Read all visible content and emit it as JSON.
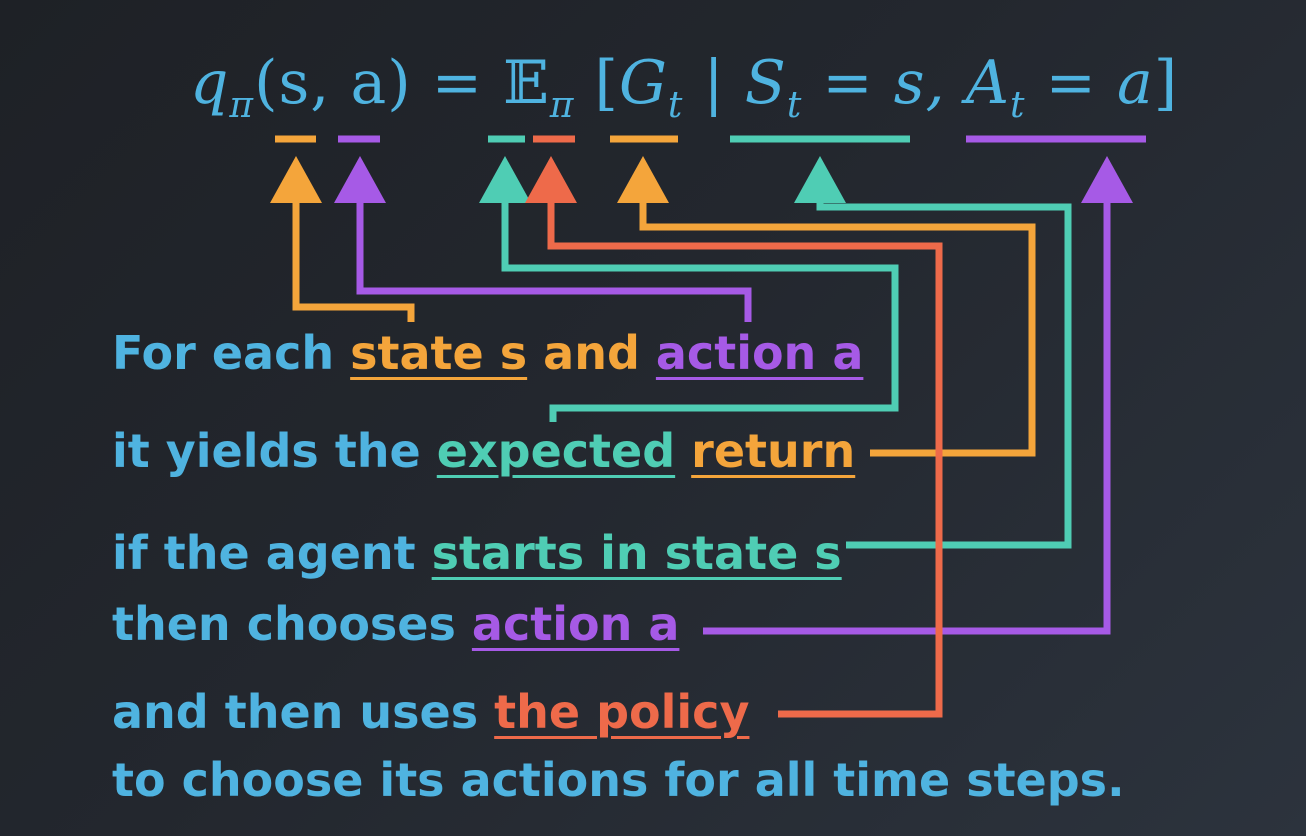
{
  "colors": {
    "text": "#4fb3e0",
    "orange": "#f4a53b",
    "purple": "#a65ae6",
    "teal": "#4fcdb4",
    "red": "#ee6a4a"
  },
  "equation": {
    "q": "q",
    "q_sub": "π",
    "args": "(s, a)",
    "equals": "=",
    "E": "𝔼",
    "E_sub": "π",
    "open": "[",
    "G": "G",
    "G_sub": "t",
    "bar": "|",
    "S": "S",
    "S_sub": "t",
    "eq_s": "= s,",
    "A": "A",
    "A_sub": "t",
    "eq_a": "= a",
    "close": "]"
  },
  "text": {
    "line1": {
      "pre": "For each ",
      "state": "state s",
      "mid": " and ",
      "action": "action a"
    },
    "line2": {
      "pre": "it yields the ",
      "expected": "expected",
      "space": " ",
      "return": "return"
    },
    "line3": {
      "pre": "if the agent ",
      "starts": "starts in state s"
    },
    "line4": {
      "pre": "then chooses ",
      "action": "action a"
    },
    "line5": {
      "pre": "and then uses ",
      "policy": "the policy"
    },
    "line6": {
      "text": "to choose its actions for all time steps."
    }
  }
}
